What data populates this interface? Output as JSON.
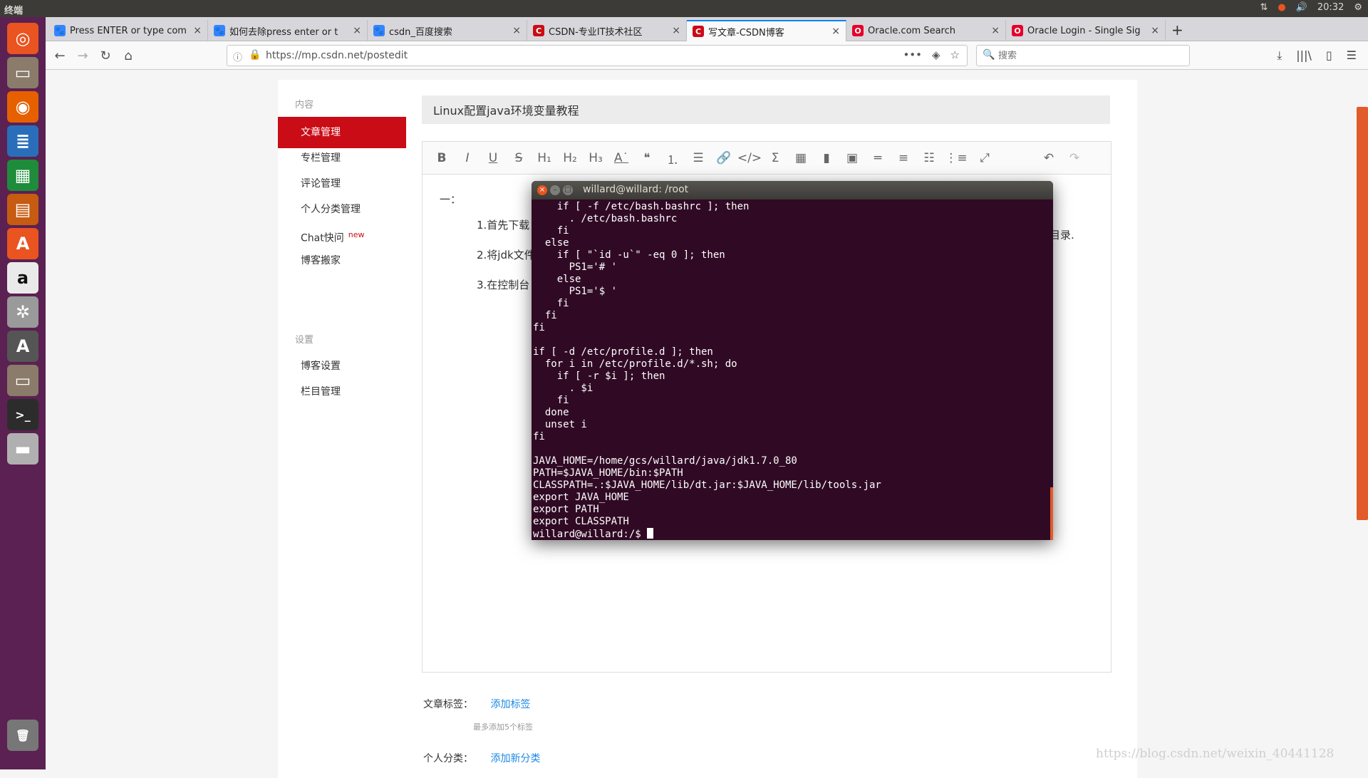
{
  "system_panel": {
    "title": "终端",
    "clock": "20:32"
  },
  "launcher": {
    "items": [
      {
        "name": "ubuntu-dash-icon",
        "glyph": "◎",
        "color": "#e95420"
      },
      {
        "name": "files-icon",
        "glyph": "▭",
        "color": "#8a7b6a"
      },
      {
        "name": "firefox-icon",
        "glyph": "◉",
        "color": "#e66000"
      },
      {
        "name": "writer-icon",
        "glyph": "≣",
        "color": "#2a6ebb"
      },
      {
        "name": "calc-icon",
        "glyph": "▦",
        "color": "#1e8c3a"
      },
      {
        "name": "impress-icon",
        "glyph": "▤",
        "color": "#c75b12"
      },
      {
        "name": "software-center-icon",
        "glyph": "A",
        "color": "#e95420"
      },
      {
        "name": "amazon-icon",
        "glyph": "a",
        "color": "#eaeaea"
      },
      {
        "name": "system-settings-icon",
        "glyph": "✲",
        "color": "#9a9a9a"
      },
      {
        "name": "software-updater-icon",
        "glyph": "A",
        "color": "#555555"
      },
      {
        "name": "files-2-icon",
        "glyph": "▭",
        "color": "#8a7b6a"
      },
      {
        "name": "terminal-icon",
        "glyph": ">_",
        "color": "#2c2c2c"
      },
      {
        "name": "drive-icon",
        "glyph": "▬",
        "color": "#b0b0b0"
      },
      {
        "name": "trash-icon",
        "glyph": "🗑",
        "color": "#777777"
      }
    ]
  },
  "tabs": [
    {
      "label": "Press ENTER or type com",
      "favicon": "baidu",
      "color": "#3385ff"
    },
    {
      "label": "如何去除press enter or t",
      "favicon": "baidu",
      "color": "#3385ff"
    },
    {
      "label": "csdn_百度搜索",
      "favicon": "baidu",
      "color": "#3385ff"
    },
    {
      "label": "CSDN-专业IT技术社区",
      "favicon": "C",
      "color": "#ca0c16"
    },
    {
      "label": "写文章-CSDN博客",
      "favicon": "C",
      "color": "#ca0c16"
    },
    {
      "label": "Oracle.com Search",
      "favicon": "O",
      "color": "#e4002b"
    },
    {
      "label": "Oracle Login - Single Sig",
      "favicon": "O",
      "color": "#e4002b"
    }
  ],
  "active_tab_index": 4,
  "navbar": {
    "url": "https://mp.csdn.net/postedit",
    "search_placeholder": "搜索"
  },
  "sidebar": {
    "section_content": "内容",
    "section_settings": "设置",
    "items": [
      {
        "label": "文章管理",
        "active": true
      },
      {
        "label": "专栏管理",
        "active": false
      },
      {
        "label": "评论管理",
        "active": false
      },
      {
        "label": "个人分类管理",
        "active": false
      },
      {
        "label": "Chat快问",
        "active": false,
        "badge": "new"
      },
      {
        "label": "博客搬家",
        "active": false
      }
    ],
    "settings_items": [
      {
        "label": "博客设置"
      },
      {
        "label": "栏目管理"
      }
    ]
  },
  "editor": {
    "title_value": "Linux配置java环境变量教程",
    "heading": "一：",
    "paragraphs": [
      "1.首先下载",
      "2.将jdk文件",
      "3.在控制台"
    ],
    "trailing_text": "目录."
  },
  "footer_form": {
    "tags_label": "文章标签：",
    "tags_link": "添加标签",
    "tags_hint": "最多添加5个标签",
    "category_label": "个人分类：",
    "category_link": "添加新分类"
  },
  "watermark": "https://blog.csdn.net/weixin_40441128",
  "terminal": {
    "title": "willard@willard: /root",
    "lines": [
      "    if [ -f /etc/bash.bashrc ]; then",
      "      . /etc/bash.bashrc",
      "    fi",
      "  else",
      "    if [ \"`id -u`\" -eq 0 ]; then",
      "      PS1='# '",
      "    else",
      "      PS1='$ '",
      "    fi",
      "  fi",
      "fi",
      "",
      "if [ -d /etc/profile.d ]; then",
      "  for i in /etc/profile.d/*.sh; do",
      "    if [ -r $i ]; then",
      "      . $i",
      "    fi",
      "  done",
      "  unset i",
      "fi",
      "",
      "JAVA_HOME=/home/gcs/willard/java/jdk1.7.0_80",
      "PATH=$JAVA_HOME/bin:$PATH",
      "CLASSPATH=.:$JAVA_HOME/lib/dt.jar:$JAVA_HOME/lib/tools.jar",
      "export JAVA_HOME",
      "export PATH",
      "export CLASSPATH"
    ],
    "prompt": "willard@willard:/$ "
  }
}
